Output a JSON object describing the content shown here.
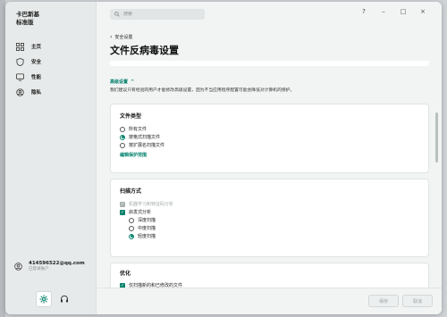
{
  "sidebar": {
    "brand_line1": "卡巴斯基",
    "brand_line2": "标准版",
    "items": [
      {
        "label": "主页",
        "icon": "grid-icon"
      },
      {
        "label": "安全",
        "icon": "shield-icon"
      },
      {
        "label": "性能",
        "icon": "monitor-icon"
      },
      {
        "label": "隐私",
        "icon": "privacy-icon"
      }
    ],
    "account": {
      "email": "414596522@qq.com",
      "sub": "已登录账户"
    }
  },
  "topbar": {
    "search_placeholder": "搜索",
    "help": "?",
    "minimize": "–",
    "maximize": "□",
    "close": "×"
  },
  "page": {
    "back_label": "安全设置",
    "title": "文件反病毒设置",
    "advanced_label": "高级设置",
    "advanced_desc": "我们建议只有经验的用户才能修改高级设置，因为不当应用程序配置可能会降低对计算机的保护。"
  },
  "file_types": {
    "title": "文件类型",
    "options": [
      "所有文件",
      "按格式扫描文件",
      "按扩展名扫描文件"
    ],
    "selected": 1,
    "edit_link": "编辑保护范围"
  },
  "scan_method": {
    "title": "扫描方式",
    "ml_label": "机器学习和特征码分析",
    "heuristic_label": "启发式分析",
    "levels": [
      "深度扫描",
      "中度扫描",
      "轻度扫描"
    ],
    "selected_level": 2
  },
  "optimization": {
    "title": "优化",
    "first_option": "仅扫描新的和已修改的文件"
  },
  "footer": {
    "save": "保存",
    "cancel": "取消"
  },
  "colors": {
    "accent": "#00806a"
  }
}
